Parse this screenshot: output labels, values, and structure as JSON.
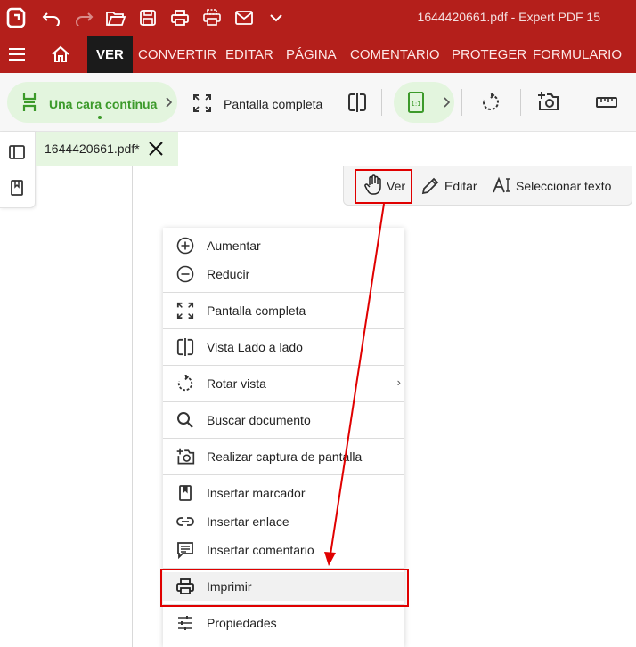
{
  "window": {
    "title": "1644420661.pdf   -   Expert PDF 15"
  },
  "quick_toolbar": {
    "icons": [
      "app-logo-icon",
      "undo-icon",
      "redo-icon",
      "open-folder-icon",
      "save-icon",
      "print-icon",
      "batch-print-icon",
      "email-icon",
      "chevron-down-icon"
    ]
  },
  "menubar": {
    "items": [
      {
        "label": "VER",
        "active": true
      },
      {
        "label": "CONVERTIR"
      },
      {
        "label": "EDITAR"
      },
      {
        "label": "PÁGINA"
      },
      {
        "label": "COMENTARIO"
      },
      {
        "label": "PROTEGER"
      },
      {
        "label": "FORMULARIO"
      }
    ]
  },
  "ribbon": {
    "page_layout_label": "Una cara continua",
    "fullscreen_label": "Pantalla completa",
    "zoom_icon_text": "1:1"
  },
  "document_tab": {
    "name": "1644420661.pdf*"
  },
  "mode_toolbar": {
    "view_label": "Ver",
    "edit_label": "Editar",
    "select_text_label": "Seleccionar texto"
  },
  "context_menu": {
    "items": [
      {
        "label": "Aumentar",
        "icon": "zoom-in-icon"
      },
      {
        "label": "Reducir",
        "icon": "zoom-out-icon"
      },
      {
        "label": "Pantalla completa",
        "icon": "fullscreen-icon"
      },
      {
        "label": "Vista Lado a lado",
        "icon": "side-by-side-icon"
      },
      {
        "label": "Rotar vista",
        "icon": "rotate-icon",
        "submenu": true
      },
      {
        "label": "Buscar documento",
        "icon": "search-icon"
      },
      {
        "label": "Realizar captura de pantalla",
        "icon": "camera-icon"
      },
      {
        "label": "Insertar marcador",
        "icon": "bookmark-icon"
      },
      {
        "label": "Insertar enlace",
        "icon": "link-icon"
      },
      {
        "label": "Insertar comentario",
        "icon": "comment-icon"
      },
      {
        "label": "Imprimir",
        "icon": "print-icon",
        "highlighted": true
      },
      {
        "label": "Propiedades",
        "icon": "properties-icon"
      }
    ],
    "submenu_chevron": "›"
  },
  "colors": {
    "brand_red": "#b41f1b",
    "accent_green": "#3c9a2a",
    "highlight_red": "#e00000",
    "pill_green_bg": "#e3f5de"
  }
}
